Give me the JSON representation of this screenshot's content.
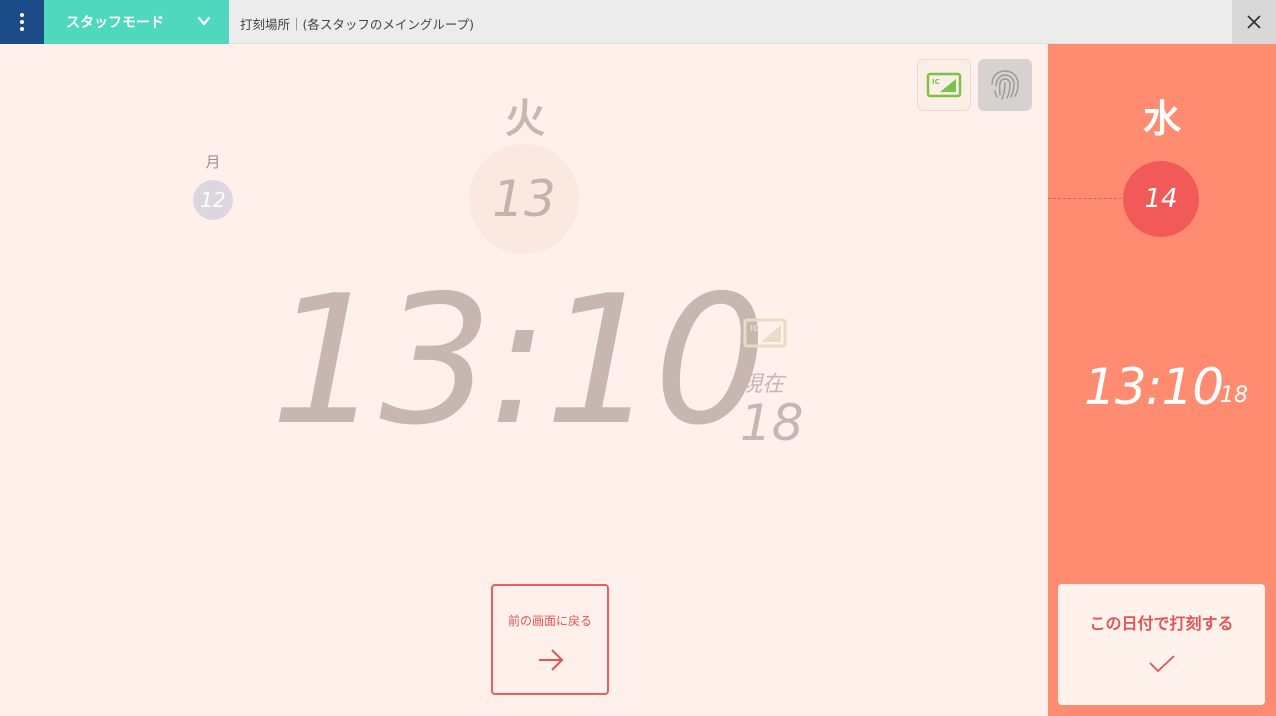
{
  "topbar": {
    "mode_label": "スタッフモード",
    "location_text": "打刻場所｜(各スタッフのメイングループ)"
  },
  "previous_day": {
    "weekday": "月",
    "date": "12"
  },
  "current_day": {
    "weekday": "火",
    "date": "13"
  },
  "clock": {
    "time": "13:10",
    "now_label": "現在",
    "seconds": "18"
  },
  "back_button": {
    "label": "前の画面に戻る"
  },
  "selected_day": {
    "weekday": "水",
    "date": "14",
    "time": "13:10",
    "seconds": "18"
  },
  "confirm_button": {
    "label": "この日付で打刻する"
  },
  "icons": {
    "menu": "vertical-dots-icon",
    "dropdown": "chevron-down-icon",
    "close": "close-icon",
    "ic_card": "ic-card-icon",
    "fingerprint": "fingerprint-icon",
    "arrow": "arrow-right-icon",
    "check": "check-icon"
  },
  "colors": {
    "menu_bg": "#1b4c87",
    "mode_bg": "#4fd8bd",
    "main_bg": "#fff0eb",
    "side_bg": "#ff8c70",
    "accent_red": "#f25a5a"
  }
}
